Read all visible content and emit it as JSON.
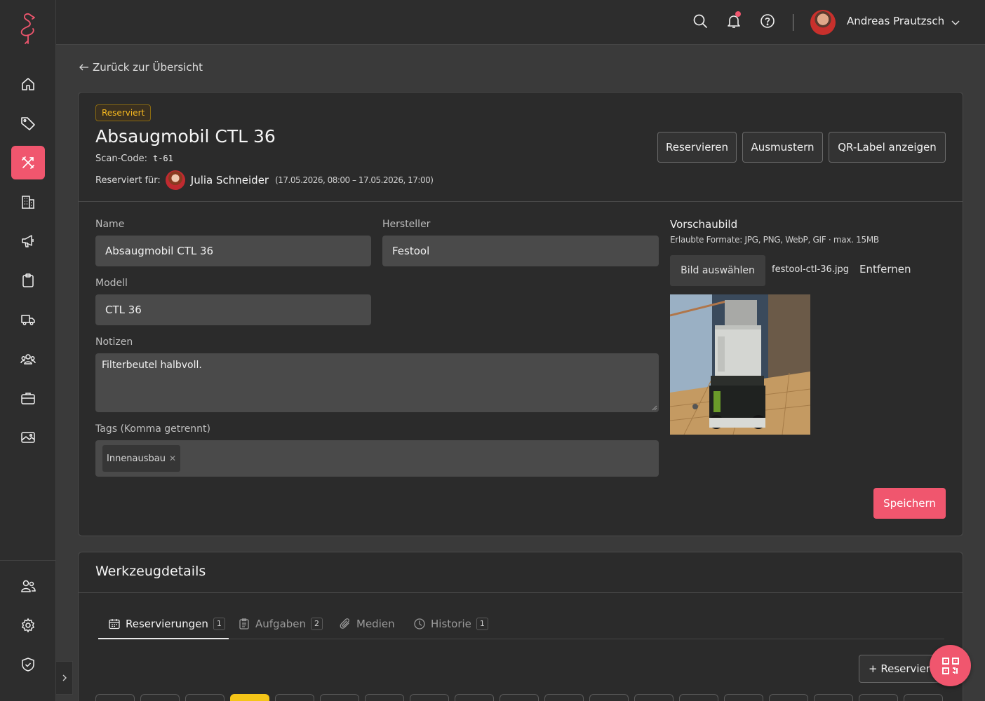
{
  "colors": {
    "accent": "#f0566e",
    "badge": "#f5b820",
    "background": "#3a3a3a",
    "surface": "#2b2b2b",
    "field": "#4a4a4a",
    "today": "#f5c518"
  },
  "sidebar": {
    "items": [
      {
        "icon": "home-icon",
        "active": false
      },
      {
        "icon": "tag-icon",
        "active": false
      },
      {
        "icon": "tools-icon",
        "active": true
      },
      {
        "icon": "building-icon",
        "active": false
      },
      {
        "icon": "megaphone-icon",
        "active": false
      },
      {
        "icon": "clipboard-icon",
        "active": false
      },
      {
        "icon": "truck-icon",
        "active": false
      },
      {
        "icon": "team-icon",
        "active": false
      },
      {
        "icon": "briefcase-icon",
        "active": false
      },
      {
        "icon": "image-icon",
        "active": false
      }
    ],
    "bottom_items": [
      {
        "icon": "users-icon"
      },
      {
        "icon": "settings-icon"
      },
      {
        "icon": "shield-check-icon"
      }
    ]
  },
  "topbar": {
    "user_name": "Andreas Prautzsch",
    "has_notification": true
  },
  "back_link": "Zurück zur Übersicht",
  "item": {
    "status_badge": "Reserviert",
    "title": "Absaugmobil CTL 36",
    "scan_label": "Scan-Code:",
    "scan_code": "t-61",
    "reserved_label": "Reserviert für:",
    "reserved_name": "Julia Schneider",
    "reserved_period": "(17.05.2026, 08:00 – 17.05.2026, 17:00)"
  },
  "actions": {
    "reserve": "Reservieren",
    "retire": "Ausmustern",
    "qr_label": "QR-Label anzeigen"
  },
  "form": {
    "name_label": "Name",
    "name_value": "Absaugmobil CTL 36",
    "manufacturer_label": "Hersteller",
    "manufacturer_value": "Festool",
    "model_label": "Modell",
    "model_value": "CTL 36",
    "notes_label": "Notizen",
    "notes_value": "Filterbeutel halbvoll.",
    "tags_label": "Tags (Komma getrennt)",
    "tags": [
      "Innenausbau"
    ],
    "save": "Speichern"
  },
  "preview": {
    "title": "Vorschaubild",
    "hint": "Erlaubte Formate: JPG, PNG, WebP, GIF · max. 15MB",
    "choose_button": "Bild auswählen",
    "file_name": "festool-ctl-36.jpg",
    "remove": "Entfernen"
  },
  "details": {
    "title": "Werkzeugdetails",
    "tabs": [
      {
        "label": "Reservierungen",
        "count": "1",
        "icon": "calendar-icon",
        "active": true
      },
      {
        "label": "Aufgaben",
        "count": "2",
        "icon": "tasks-icon",
        "active": false
      },
      {
        "label": "Medien",
        "count": "",
        "icon": "paperclip-icon",
        "active": false
      },
      {
        "label": "Historie",
        "count": "1",
        "icon": "clock-icon",
        "active": false
      }
    ],
    "add_reservation": "+ Reservieren"
  }
}
